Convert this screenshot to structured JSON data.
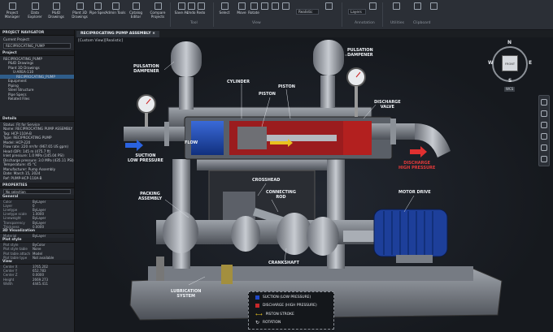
{
  "ribbon": {
    "buttons": [
      "Project Manager",
      "Data Explorer",
      "P&ID Drawings",
      "Plant 3D Drawings",
      "Pipe Spec",
      "Admin Tools",
      "Catalog Editor",
      "Compare Projects",
      "Save As",
      "Undo",
      "Redo",
      "Select",
      "Move",
      "Rotate",
      "",
      "",
      "",
      "",
      "Realistic",
      "Layers",
      "",
      "",
      "",
      ""
    ],
    "groups": {
      "tool": "Tool",
      "view": "View",
      "annotation": "Annotation",
      "utilities": "Utilities",
      "clipboard": "Clipboard"
    },
    "visual_style": "Realistic",
    "layers_label": "Layers"
  },
  "left": {
    "navigator_title": "PROJECT NAVIGATOR",
    "current_project_label": "Current Project:",
    "current_project_value": "RECIPROCATING_PUMP",
    "project_header": "Project",
    "tree": [
      "RECIPROCATING_PUMP",
      "P&ID Drawings",
      "Plant 3D Drawings",
      "U-AREA-110",
      "RECIPROCATING_PUMP",
      "Equipment",
      "Piping",
      "Steel Structure",
      "Pipe Specs",
      "Related Files"
    ],
    "details_header": "Details",
    "details": [
      "Status: Fit for Service",
      "Name: RECIPROCATING PUMP ASSEMBLY",
      "Tag: HCP-110A-B",
      "Type: RECIPROCATING PUMP",
      "Model: HCP-220",
      "Flow rate: 220 m³/hr (967.65 US gpm)",
      "Head (DP): 145 m (475.7 ft)",
      "Inlet pressure: 1.0 MPa (145.04 PSI)",
      "Discharge pressure: 3.0 MPa (435.11 PSI)",
      "Temperature: 45 °C",
      "Manufacturer: Pump Assembly",
      "Date: March 15, 2024",
      "Ref: PUMP-HCP-110A-B"
    ],
    "properties_header": "PROPERTIES",
    "selection": "No selection",
    "general_header": "General",
    "general": [
      [
        "Color",
        "ByLayer"
      ],
      [
        "Layer",
        "0"
      ],
      [
        "Linetype",
        "ByLayer"
      ],
      [
        "Linetype scale",
        "1.0000"
      ],
      [
        "Lineweight",
        "ByLayer"
      ],
      [
        "Transparency",
        "ByLayer"
      ],
      [
        "Thickness",
        "0.0000"
      ]
    ],
    "viz_header": "3D Visualization",
    "viz": [
      [
        "Material",
        "ByLayer"
      ]
    ],
    "plot_header": "Plot style",
    "plot": [
      [
        "Plot style",
        "ByColor"
      ],
      [
        "Plot style table",
        "None"
      ],
      [
        "Plot table attach",
        "Model"
      ],
      [
        "Plot table type",
        "Not available"
      ]
    ],
    "view_header": "View",
    "view": [
      [
        "Center X",
        "3765.202"
      ],
      [
        "Center Y",
        "652.783"
      ],
      [
        "Center Z",
        "0.0000"
      ],
      [
        "Height",
        "2669.273"
      ],
      [
        "Width",
        "4445.411"
      ]
    ]
  },
  "tab": {
    "title": "RECIPROCATING PUMP ASSEMBLY",
    "viewport_label": "[Custom View][Realistic]"
  },
  "viewcube": {
    "n": "N",
    "s": "S",
    "e": "E",
    "w": "W",
    "face": "FRONT",
    "wcs": "WCS"
  },
  "callouts": {
    "pd_left": "PULSATION\nDAMPENER",
    "pd_right": "PULSATION\nDAMPENER",
    "cylinder": "CYLINDER",
    "piston1": "PISTON",
    "piston2": "PISTON",
    "discharge_valve": "DISCHARGE\nVALVE",
    "flow": "FLOW",
    "suction": "SUCTION\nLOW PRESSURE",
    "discharge": "DISCHARGE\nHIGH PRESSURE",
    "crosshead": "CROSSHEAD",
    "packing": "PACKING\nASSEMBLY",
    "conrod": "CONNECTING\nROD",
    "motor": "MOTOR DRIVE",
    "crankshaft": "CRANKSHAFT",
    "lube": "LUBRICATION\nSYSTEM"
  },
  "legend": {
    "items": [
      {
        "label": "SUCTION (LOW PRESSURE)",
        "color": "#1e48c8"
      },
      {
        "label": "DISCHARGE (HIGH PRESSURE)",
        "color": "#c8282a"
      },
      {
        "label": "PISTON STROKE",
        "color": "#e8c21e"
      },
      {
        "label": "ROTATION",
        "color": "#ffffff"
      }
    ]
  },
  "colors": {
    "suction": "#1e48c8",
    "discharge": "#c8282a",
    "accent": "#e8c21e"
  }
}
